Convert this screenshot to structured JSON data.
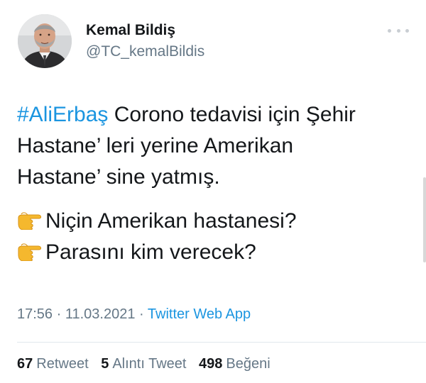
{
  "author": {
    "display_name": "Kemal Bildiş",
    "handle": "@TC_kemalBildis"
  },
  "tweet": {
    "hashtag": "#AliErbaş",
    "line1_rest": " Corono tedavisi için Şehir",
    "line2": "Hastane’ leri yerine Amerikan",
    "line3": "Hastane’ sine yatmış.",
    "bullets": [
      "Niçin Amerikan hastanesi?",
      "Parasını kim verecek?"
    ]
  },
  "meta": {
    "time": "17:56",
    "sep1": " · ",
    "date": "11.03.2021",
    "sep2": " · ",
    "source": "Twitter Web App"
  },
  "stats": {
    "retweets_count": "67",
    "retweets_label": "Retweet",
    "quotes_count": "5",
    "quotes_label": "Alıntı Tweet",
    "likes_count": "498",
    "likes_label": "Beğeni"
  },
  "icons": {
    "more": "more-icon",
    "pointing": "backhand-index-pointing-right-icon"
  },
  "colors": {
    "link": "#1b95e0",
    "secondary_text": "#657786",
    "primary_text": "#14171a"
  }
}
